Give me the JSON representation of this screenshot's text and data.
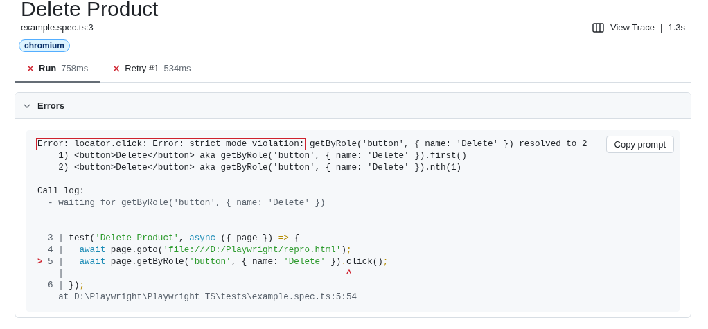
{
  "title": "Delete Product",
  "location": "example.spec.ts:3",
  "tags": [
    {
      "label": "chromium"
    }
  ],
  "header_actions": {
    "view_trace": "View Trace",
    "separator": "|",
    "duration": "1.3s"
  },
  "tabs": [
    {
      "label": "Run",
      "duration": "758ms",
      "selected": true,
      "failed": true
    },
    {
      "label": "Retry #1",
      "duration": "534ms",
      "selected": false,
      "failed": true
    }
  ],
  "errors_panel": {
    "title": "Errors",
    "expanded": true,
    "copy_button": "Copy prompt",
    "blocks": [
      [
        [
          {
            "kind": "highlight",
            "text": "Error: locator.click: Error: strict mode violation:"
          },
          {
            "kind": "plain",
            "text": " getByRole('button', { name: 'Delete' }) resolved to 2"
          }
        ],
        [
          {
            "kind": "plain",
            "text": "    1) <button>Delete</button> aka getByRole('button', { name: 'Delete' }).first()"
          }
        ],
        [
          {
            "kind": "plain",
            "text": "    2) <button>Delete</button> aka getByRole('button', { name: 'Delete' }).nth(1)"
          }
        ]
      ],
      [
        [
          {
            "kind": "plain",
            "text": "Call log:"
          }
        ],
        [
          {
            "kind": "dim",
            "text": "  - waiting for getByRole('button', { name: 'Delete' })"
          }
        ]
      ],
      [
        [
          {
            "kind": "gutter",
            "text": "  3 | "
          },
          {
            "kind": "plain",
            "text": "test("
          },
          {
            "kind": "string",
            "text": "'Delete Product'"
          },
          {
            "kind": "plain",
            "text": ", "
          },
          {
            "kind": "keyword",
            "text": "async"
          },
          {
            "kind": "plain",
            "text": " ({ page }) "
          },
          {
            "kind": "operator",
            "text": "=>"
          },
          {
            "kind": "plain",
            "text": " {"
          }
        ],
        [
          {
            "kind": "gutter",
            "text": "  4 |   "
          },
          {
            "kind": "keyword",
            "text": "await"
          },
          {
            "kind": "plain",
            "text": " page.goto("
          },
          {
            "kind": "string",
            "text": "'file:///D:/Playwright/repro.html'"
          },
          {
            "kind": "plain",
            "text": ")"
          },
          {
            "kind": "operator",
            "text": ";"
          }
        ],
        [
          {
            "kind": "marker",
            "text": ">"
          },
          {
            "kind": "gutter",
            "text": " 5 |   "
          },
          {
            "kind": "keyword",
            "text": "await"
          },
          {
            "kind": "plain",
            "text": " page.getByRole("
          },
          {
            "kind": "string",
            "text": "'button'"
          },
          {
            "kind": "plain",
            "text": ", { name: "
          },
          {
            "kind": "string",
            "text": "'Delete'"
          },
          {
            "kind": "plain",
            "text": " })"
          },
          {
            "kind": "operator",
            "text": "."
          },
          {
            "kind": "plain",
            "text": "click()"
          },
          {
            "kind": "operator",
            "text": ";"
          }
        ],
        [
          {
            "kind": "gutter",
            "text": "    |                                                      "
          },
          {
            "kind": "marker",
            "text": "^"
          }
        ],
        [
          {
            "kind": "gutter",
            "text": "  6 | "
          },
          {
            "kind": "plain",
            "text": "})"
          },
          {
            "kind": "operator",
            "text": ";"
          }
        ],
        [
          {
            "kind": "dim",
            "text": "    at D:\\Playwright\\Playwright TS\\tests\\example.spec.ts:5:54"
          }
        ]
      ]
    ]
  }
}
